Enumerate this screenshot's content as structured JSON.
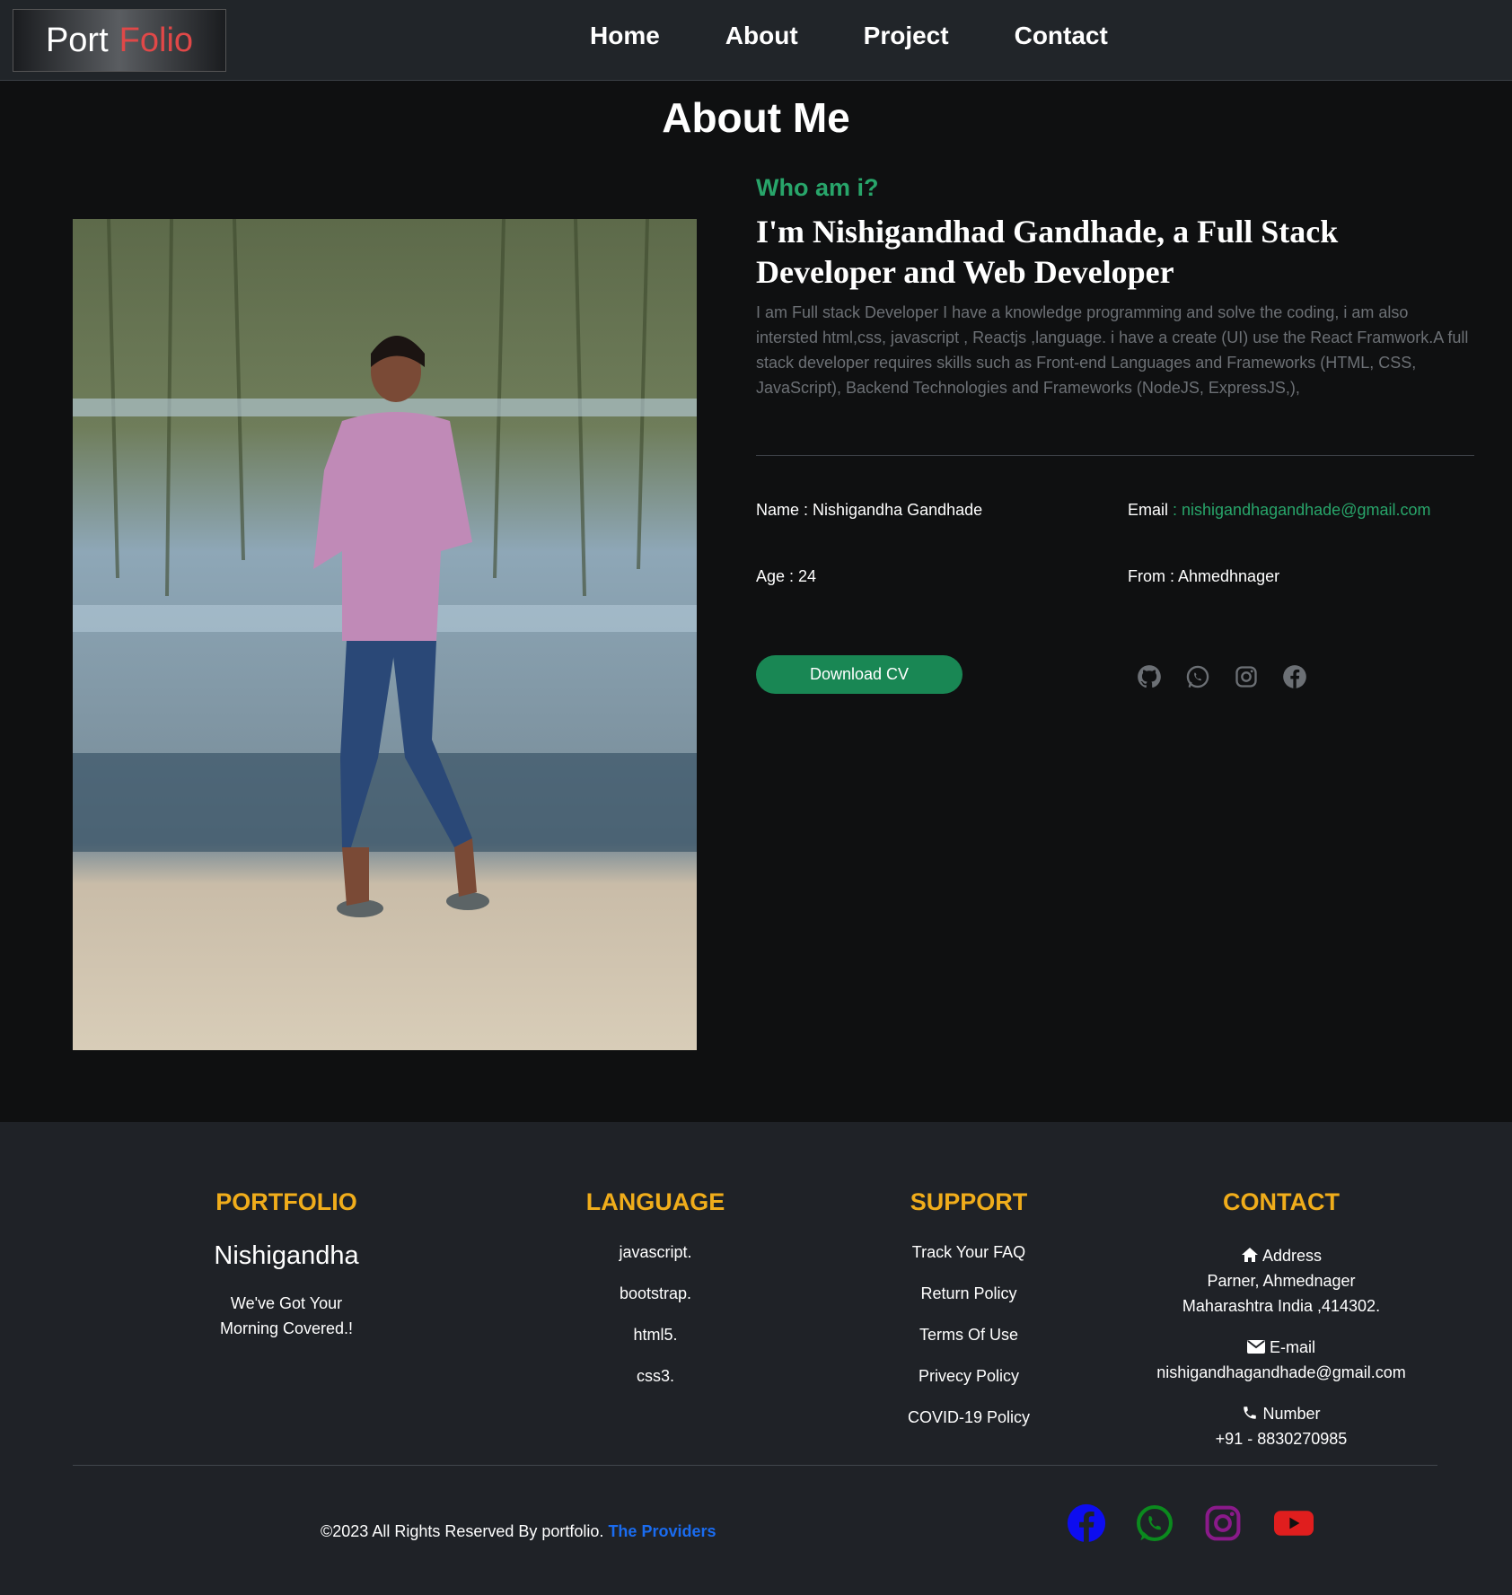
{
  "nav": {
    "brand_first": "Port",
    "brand_second": "Folio",
    "links": [
      "Home",
      "About",
      "Project",
      "Contact"
    ]
  },
  "about": {
    "title": "About Me",
    "who": "Who am i?",
    "headline": "I'm Nishigandhad Gandhade, a Full Stack Developer and Web Developer",
    "description": "I am Full stack Developer I have a knowledge programming and solve the coding, i am also intersted html,css, javascript , Reactjs ,language. i have a create (UI) use the React Framwork.A full stack developer requires skills such as Front-end Languages and Frameworks (HTML, CSS, JavaScript), Backend Technologies and Frameworks (NodeJS, ExpressJS,),",
    "name_label": "Name : Nishigandha Gandhade",
    "email_label": "Email",
    "email_value": " : nishigandhagandhade@gmail.com",
    "age_label": "Age : 24",
    "from_label": "From : Ahmedhnager",
    "download_label": "Download CV",
    "social_icons": [
      "github-icon",
      "whatsapp-icon",
      "instagram-icon",
      "facebook-icon"
    ]
  },
  "footer": {
    "portfolio": {
      "head": "PORTFOLIO",
      "name": "Nishigandha",
      "tagline1": "We've Got Your",
      "tagline2": "Morning Covered.!"
    },
    "language": {
      "head": "LANGUAGE",
      "items": [
        "javascript.",
        "bootstrap.",
        "html5.",
        "css3."
      ]
    },
    "support": {
      "head": "SUPPORT",
      "items": [
        "Track Your FAQ",
        "Return Policy",
        "Terms Of Use",
        "Privecy Policy",
        "COVID-19 Policy"
      ]
    },
    "contact": {
      "head": "CONTACT",
      "address_label": "Address",
      "address_line1": "Parner, Ahmednager",
      "address_line2": "Maharashtra India ,414302.",
      "email_label": "E-mail",
      "email_value": "nishigandhagandhade@gmail.com",
      "number_label": "Number",
      "number_value": "+91 - 8830270985"
    },
    "copyright": "©2023 All Rights Reserved By portfolio.",
    "providers": "The Providers",
    "social_colors": {
      "facebook": "#0d0df0",
      "whatsapp": "#0b8a1e",
      "instagram": "#8a1a8a",
      "youtube": "#e01e1e"
    }
  }
}
